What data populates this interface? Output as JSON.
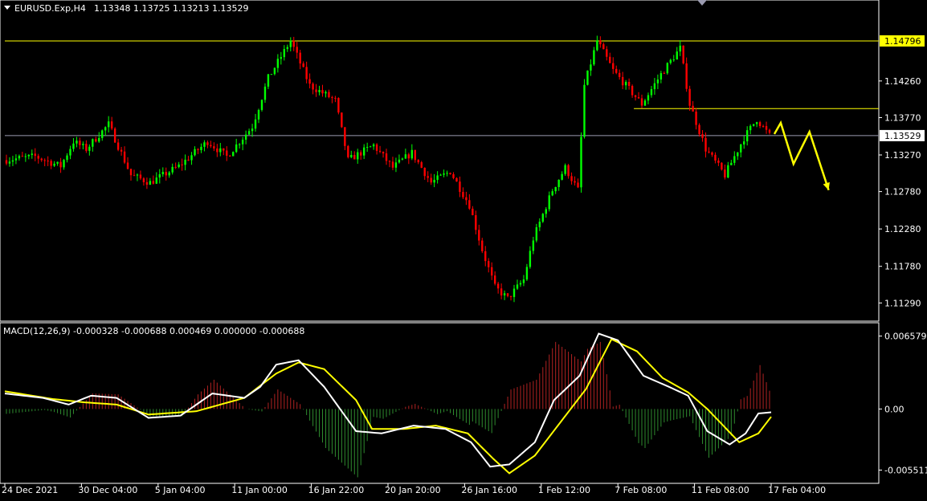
{
  "header": {
    "symbol": "EURUSD.Exp,H4",
    "ohlc": "1.13348 1.13725 1.13213 1.13529"
  },
  "macd_header": {
    "label": "MACD(12,26,9) -0.000328 -0.000688 0.000469 0.000000 -0.000688"
  },
  "colors": {
    "background": "#000000",
    "frame": "#ffffff",
    "bull_candle": "#00ff00",
    "bear_candle": "#ff0000",
    "level_line": "#ffff00",
    "price_line": "#9b9bb0",
    "macd_main": "#ffffff",
    "macd_signal": "#ffff00",
    "hist_pos": "#b22222",
    "hist_neg": "#2e8b2e",
    "arrow": "#ffff00"
  },
  "chart_data": [
    {
      "type": "candlestick",
      "name": "EURUSD H4",
      "y_ticks": [
        "1.14260",
        "1.13770",
        "1.13270",
        "1.12780",
        "1.12280",
        "1.11780",
        "1.11290"
      ],
      "y_tick_values": [
        1.1426,
        1.1377,
        1.1327,
        1.1278,
        1.1228,
        1.1178,
        1.1129
      ],
      "ylim": [
        1.111,
        1.1515
      ],
      "x_ticks": [
        "24 Dec 2021",
        "30 Dec 04:00",
        "5 Jan 04:00",
        "11 Jan 00:00",
        "16 Jan 22:00",
        "20 Jan 20:00",
        "26 Jan 16:00",
        "1 Feb 12:00",
        "7 Feb 08:00",
        "11 Feb 08:00",
        "17 Feb 04:00"
      ],
      "x_tick_bar_index": [
        0,
        24,
        48,
        72,
        96,
        120,
        144,
        168,
        192,
        216,
        240
      ],
      "bar_count": 240,
      "price_path": [
        [
          0,
          1.132
        ],
        [
          10,
          1.1325
        ],
        [
          18,
          1.1312
        ],
        [
          22,
          1.1345
        ],
        [
          26,
          1.1335
        ],
        [
          33,
          1.1368
        ],
        [
          40,
          1.13
        ],
        [
          46,
          1.129
        ],
        [
          55,
          1.1312
        ],
        [
          64,
          1.1345
        ],
        [
          70,
          1.1325
        ],
        [
          78,
          1.1365
        ],
        [
          83,
          1.143
        ],
        [
          90,
          1.148
        ],
        [
          96,
          1.142
        ],
        [
          104,
          1.14
        ],
        [
          108,
          1.132
        ],
        [
          116,
          1.134
        ],
        [
          122,
          1.131
        ],
        [
          128,
          1.133
        ],
        [
          134,
          1.129
        ],
        [
          140,
          1.1305
        ],
        [
          146,
          1.126
        ],
        [
          150,
          1.12
        ],
        [
          154,
          1.115
        ],
        [
          158,
          1.1135
        ],
        [
          163,
          1.116
        ],
        [
          166,
          1.1215
        ],
        [
          172,
          1.128
        ],
        [
          176,
          1.131
        ],
        [
          180,
          1.128
        ],
        [
          182,
          1.142
        ],
        [
          186,
          1.148
        ],
        [
          191,
          1.144
        ],
        [
          195,
          1.142
        ],
        [
          200,
          1.1395
        ],
        [
          206,
          1.1435
        ],
        [
          212,
          1.147
        ],
        [
          215,
          1.1395
        ],
        [
          220,
          1.1335
        ],
        [
          226,
          1.13
        ],
        [
          232,
          1.135
        ],
        [
          236,
          1.1375
        ],
        [
          240,
          1.1353
        ]
      ],
      "levels": [
        {
          "label": "1.14796",
          "value": 1.14796,
          "from_bar": 0,
          "tag_bg": "#ffff00"
        },
        {
          "label": "",
          "value": 1.1389,
          "from_bar": 197
        },
        {
          "label": "1.13529",
          "value": 1.13529,
          "from_bar": 0,
          "tag_bg": "#ffffff"
        }
      ],
      "projection": [
        [
          241,
          1.1355
        ],
        [
          243,
          1.137
        ],
        [
          247,
          1.1315
        ],
        [
          252,
          1.1358
        ],
        [
          258,
          1.128
        ]
      ]
    },
    {
      "type": "macd",
      "name": "MACD(12,26,9)",
      "y_ticks": [
        "0.006579",
        "0.00",
        "-0.005511"
      ],
      "y_tick_values": [
        0.006579,
        0.0,
        -0.005511
      ],
      "ylim": [
        -0.0062,
        0.0072
      ],
      "main_path": [
        [
          0,
          0.0014
        ],
        [
          12,
          0.001
        ],
        [
          20,
          0.0004
        ],
        [
          27,
          0.0012
        ],
        [
          35,
          0.001
        ],
        [
          45,
          -0.0008
        ],
        [
          55,
          -0.0006
        ],
        [
          65,
          0.0014
        ],
        [
          75,
          0.001
        ],
        [
          80,
          0.002
        ],
        [
          85,
          0.004
        ],
        [
          92,
          0.0044
        ],
        [
          100,
          0.002
        ],
        [
          110,
          -0.002
        ],
        [
          118,
          -0.0022
        ],
        [
          128,
          -0.0015
        ],
        [
          138,
          -0.0018
        ],
        [
          146,
          -0.003
        ],
        [
          152,
          -0.0052
        ],
        [
          158,
          -0.005
        ],
        [
          166,
          -0.003
        ],
        [
          172,
          0.0008
        ],
        [
          180,
          0.003
        ],
        [
          186,
          0.0068
        ],
        [
          192,
          0.0062
        ],
        [
          200,
          0.003
        ],
        [
          208,
          0.002
        ],
        [
          214,
          0.0012
        ],
        [
          220,
          -0.002
        ],
        [
          227,
          -0.0032
        ],
        [
          232,
          -0.0022
        ],
        [
          236,
          -0.0004
        ],
        [
          240,
          -0.0003
        ]
      ],
      "signal_path": [
        [
          0,
          0.0016
        ],
        [
          15,
          0.0009
        ],
        [
          25,
          0.0006
        ],
        [
          35,
          0.0004
        ],
        [
          45,
          -0.0005
        ],
        [
          60,
          -0.0002
        ],
        [
          75,
          0.001
        ],
        [
          85,
          0.0032
        ],
        [
          92,
          0.0042
        ],
        [
          100,
          0.0036
        ],
        [
          110,
          0.0008
        ],
        [
          115,
          -0.0018
        ],
        [
          125,
          -0.0018
        ],
        [
          135,
          -0.0015
        ],
        [
          145,
          -0.0022
        ],
        [
          153,
          -0.0045
        ],
        [
          158,
          -0.0058
        ],
        [
          166,
          -0.0042
        ],
        [
          174,
          -0.0012
        ],
        [
          182,
          0.0018
        ],
        [
          190,
          0.0063
        ],
        [
          198,
          0.0052
        ],
        [
          206,
          0.0028
        ],
        [
          214,
          0.0015
        ],
        [
          220,
          0.0
        ],
        [
          230,
          -0.003
        ],
        [
          236,
          -0.0022
        ],
        [
          240,
          -0.0007
        ]
      ]
    }
  ]
}
